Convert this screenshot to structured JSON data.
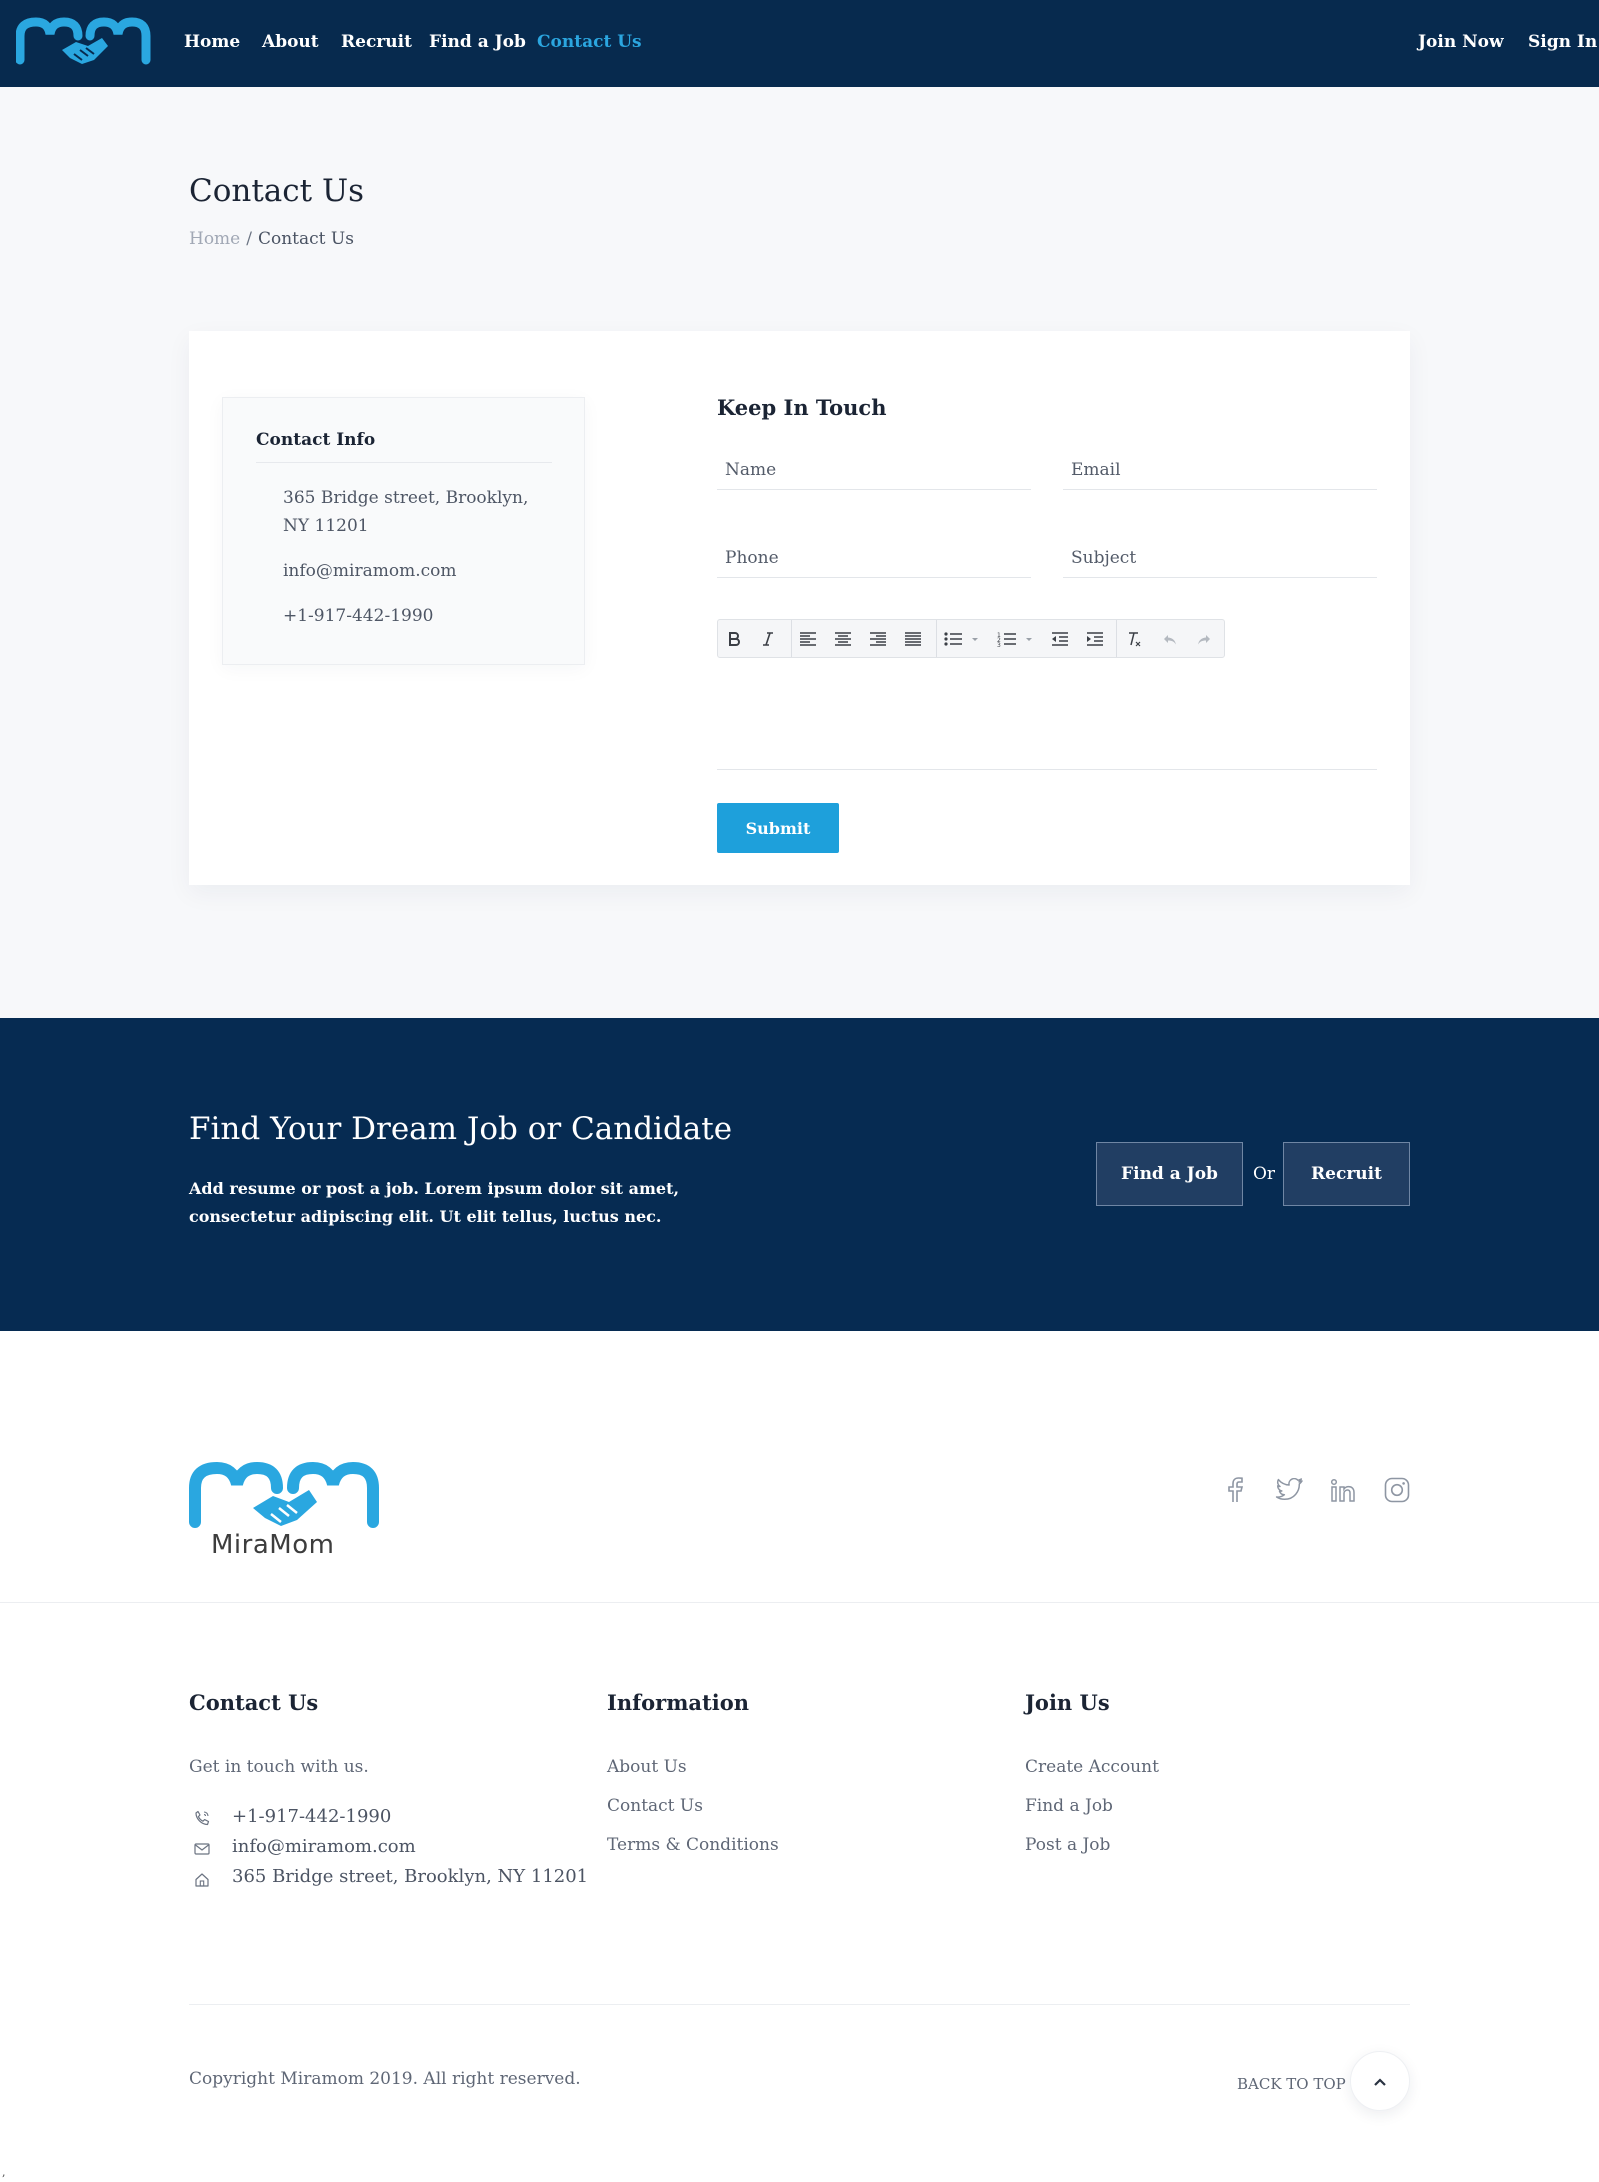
{
  "nav": {
    "items": [
      {
        "label": "Home"
      },
      {
        "label": "About"
      },
      {
        "label": "Recruit"
      },
      {
        "label": "Find a Job"
      },
      {
        "label": "Contact Us",
        "active": true
      }
    ],
    "join_label": "Join Now",
    "signin_label": "Sign In",
    "active_color": "#2ba6e0",
    "bg_color": "#072a4e"
  },
  "header": {
    "title": "Contact Us",
    "breadcrumb": {
      "home": "Home",
      "separator": "/",
      "current": "Contact Us"
    }
  },
  "contact_info": {
    "title": "Contact Info",
    "address": "365 Bridge street, Brooklyn, NY 11201",
    "email": "info@miramom.com",
    "phone": "+1-917-442-1990"
  },
  "form": {
    "title": "Keep In Touch",
    "name_placeholder": "Name",
    "email_placeholder": "Email",
    "phone_placeholder": "Phone",
    "subject_placeholder": "Subject",
    "toolbar": [
      "bold-icon",
      "italic-icon",
      "align-left-icon",
      "align-center-icon",
      "align-right-icon",
      "align-justify-icon",
      "bullet-list-icon",
      "numbered-list-icon",
      "outdent-icon",
      "indent-icon",
      "clear-format-icon",
      "undo-icon",
      "redo-icon"
    ],
    "submit_label": "Submit",
    "submit_color": "#1ea0db"
  },
  "cta": {
    "title": "Find Your Dream Job or Candidate",
    "text": "Add resume or post a job. Lorem ipsum dolor sit amet, consectetur adipiscing elit. Ut elit tellus, luctus nec.",
    "find_label": "Find a Job",
    "or_label": "Or",
    "recruit_label": "Recruit",
    "bg_color": "#062b52"
  },
  "footer": {
    "logo_text": "MiraMom",
    "social": [
      "facebook-icon",
      "twitter-icon",
      "linkedin-icon",
      "instagram-icon"
    ],
    "contact": {
      "title": "Contact Us",
      "tagline": "Get in touch with us.",
      "phone": "+1-917-442-1990",
      "email": "info@miramom.com",
      "address": "365 Bridge street, Brooklyn, NY 11201"
    },
    "information": {
      "title": "Information",
      "links": [
        "About Us",
        "Contact Us",
        "Terms & Conditions"
      ]
    },
    "join": {
      "title": "Join Us",
      "links": [
        "Create Account",
        "Find a Job",
        "Post a Job"
      ]
    },
    "copyright": "Copyright Miramom 2019. All right reserved.",
    "back_to_top": "BACK TO TOP"
  },
  "stray_mark": ","
}
